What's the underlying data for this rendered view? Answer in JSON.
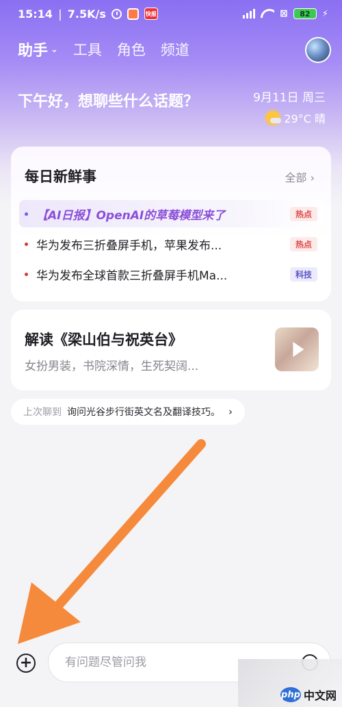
{
  "status_bar": {
    "time": "15:14",
    "speed": "7.5K/s",
    "battery": "82"
  },
  "nav": {
    "active": "助手",
    "tabs": [
      "工具",
      "角色",
      "频道"
    ]
  },
  "greeting": {
    "text": "下午好，想聊些什么话题？",
    "date": "9月11日 周三",
    "weather": "29°C 晴"
  },
  "daily_news": {
    "title": "每日新鲜事",
    "all_label": "全部 ›",
    "items": [
      {
        "text": "【AI日报】OpenAI的草莓模型来了",
        "tag": "热点"
      },
      {
        "text": "华为发布三折叠屏手机，苹果发布...",
        "tag": "热点"
      },
      {
        "text": "华为发布全球首款三折叠屏手机Ma...",
        "tag": "科技"
      }
    ]
  },
  "feature_card": {
    "title": "解读《梁山伯与祝英台》",
    "subtitle": "女扮男装，书院深情，生死契阔..."
  },
  "last_chat": {
    "prefix": "上次聊到",
    "topic": "询问光谷步行街英文名及翻译技巧。",
    "arrow": "›"
  },
  "composer": {
    "plus": "+",
    "placeholder": "有问题尽管问我"
  },
  "watermark": {
    "php": "php",
    "site": "中文网"
  },
  "colors": {
    "accent": "#8a6ff2",
    "annotation_arrow": "#f58a3c",
    "hot_tag": "#e04a4a",
    "tech_tag": "#5a54c7"
  }
}
